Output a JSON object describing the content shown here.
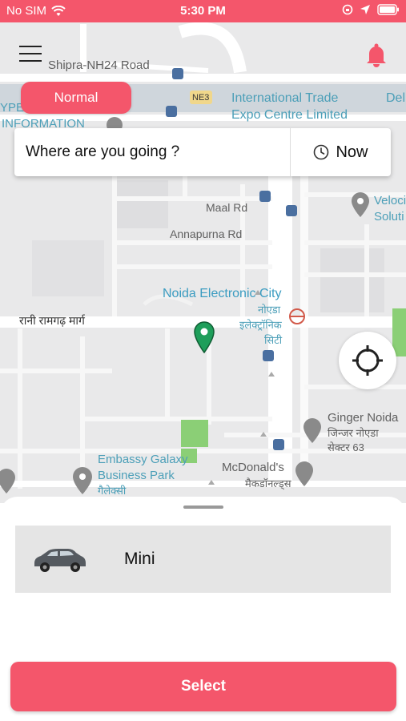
{
  "status_bar": {
    "carrier": "No SIM",
    "time": "5:30 PM"
  },
  "map": {
    "labels": {
      "shipra": "Shipra-NH24 Road",
      "ne3": "NE3",
      "trade_line1": "International Trade",
      "trade_line2": "Expo Centre Limited",
      "delhi": "Del",
      "ype": "YPE",
      "information": "INFORMATION",
      "maal": "Maal Rd",
      "annapurna": "Annapurna Rd",
      "veloci_line1": "Veloci",
      "veloci_line2": "Soluti",
      "noida_ec": "Noida Electronic City",
      "noida_hi_line1": "नोएडा",
      "noida_hi_line2": "इलेक्ट्रॉनिक",
      "noida_hi_line3": "सिटी",
      "rani": "रानी रामगढ़ मार्ग",
      "ginger_line1": "Ginger Noida",
      "ginger_line2": "जिन्जर नोएडा",
      "ginger_line3": "सेक्टर 63",
      "embassy_line1": "Embassy Galaxy",
      "embassy_line2": "Business Park",
      "embassy_line3": "गैलेक्सी",
      "mcd_line1": "McDonald's",
      "mcd_line2": "मैकडॉनल्ड्स"
    }
  },
  "header": {
    "mode_label": "Normal"
  },
  "search": {
    "placeholder": "Where are you going ?",
    "time_label": "Now"
  },
  "vehicles": [
    {
      "name": "Mini"
    }
  ],
  "actions": {
    "select_label": "Select"
  },
  "colors": {
    "accent": "#f4566b",
    "pin": "#1e9e5a"
  }
}
